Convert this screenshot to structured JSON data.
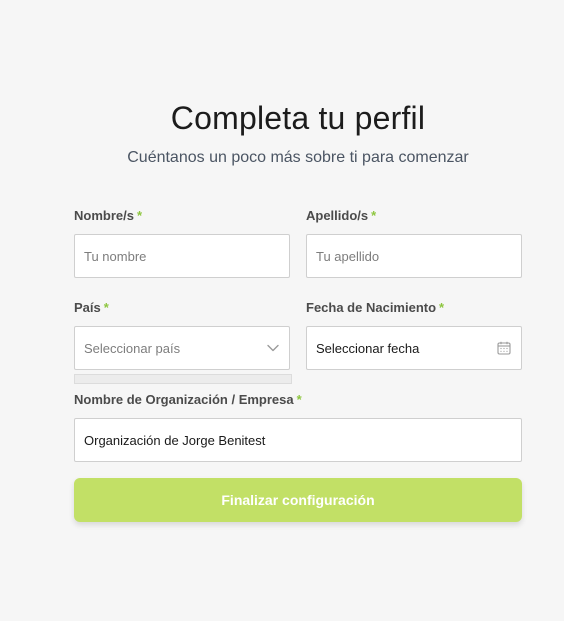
{
  "header": {
    "title": "Completa tu perfil",
    "subtitle": "Cuéntanos un poco más sobre ti para comenzar"
  },
  "form": {
    "required_mark": "*",
    "first_name": {
      "label": "Nombre/s",
      "placeholder": "Tu nombre",
      "value": ""
    },
    "last_name": {
      "label": "Apellido/s",
      "placeholder": "Tu apellido",
      "value": ""
    },
    "country": {
      "label": "País",
      "placeholder": "Seleccionar país",
      "value": ""
    },
    "birth_date": {
      "label": "Fecha de Nacimiento",
      "value": "Seleccionar fecha"
    },
    "organization": {
      "label": "Nombre de Organización / Empresa",
      "value": "Organización de Jorge Benitest"
    },
    "submit_label": "Finalizar configuración"
  },
  "colors": {
    "accent": "#c2e066",
    "required": "#8ec63f",
    "background": "#f6f6f6"
  },
  "icons": {
    "country_dropdown": "chevron-down-icon",
    "birth_date": "calendar-icon"
  }
}
